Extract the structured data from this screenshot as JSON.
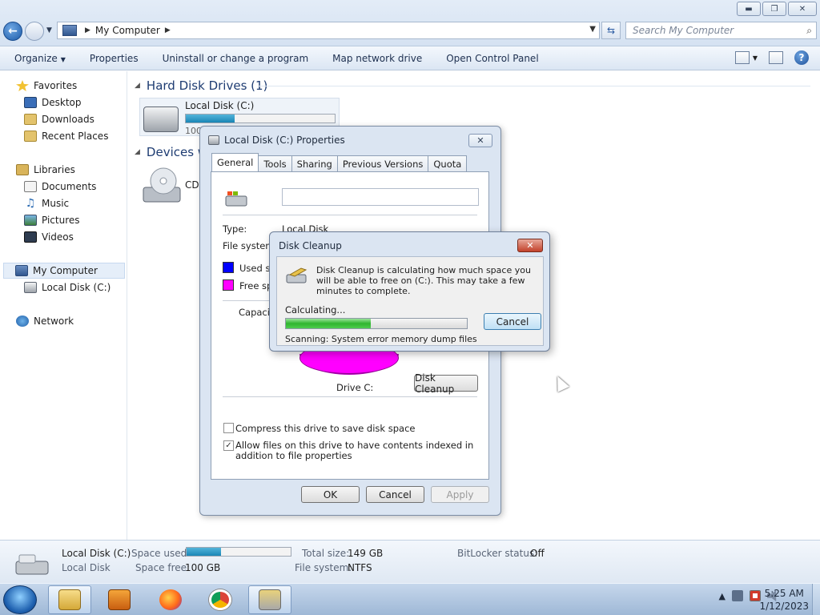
{
  "window": {
    "address_path": "My Computer",
    "search_placeholder": "Search My Computer",
    "controls": {
      "minimize": "▬",
      "maximize": "❐",
      "close": "✕"
    }
  },
  "command_bar": {
    "organize": "Organize",
    "properties": "Properties",
    "uninstall": "Uninstall or change a program",
    "map_drive": "Map network drive",
    "control_panel": "Open Control Panel"
  },
  "sidebar": {
    "favorites": "Favorites",
    "desktop": "Desktop",
    "downloads": "Downloads",
    "recent_places": "Recent Places",
    "libraries": "Libraries",
    "documents": "Documents",
    "music": "Music",
    "pictures": "Pictures",
    "videos": "Videos",
    "my_computer": "My Computer",
    "local_disk": "Local Disk (C:)",
    "network": "Network"
  },
  "content": {
    "hdd_header": "Hard Disk Drives (1)",
    "devices_header": "Devices wi",
    "drive_c_name": "Local Disk (C:)",
    "drive_c_free_text": "100",
    "drive_c_used_fraction": 0.33,
    "cd_label": "CD"
  },
  "properties_dialog": {
    "title": "Local Disk (C:) Properties",
    "tabs": [
      "General",
      "Tools",
      "Sharing",
      "Previous Versions",
      "Quota"
    ],
    "type_label": "Type:",
    "type_value": "Local Disk",
    "fs_label": "File system:",
    "used_label": "Used sp",
    "free_label": "Free spa",
    "capacity_label": "Capacit",
    "drive_label": "Drive C:",
    "disk_cleanup_button": "Disk Cleanup",
    "compress_label": "Compress this drive to save disk space",
    "index_label": "Allow files on this drive to have contents indexed in addition to file properties",
    "ok": "OK",
    "cancel": "Cancel",
    "apply": "Apply",
    "colors": {
      "used": "#0000ff",
      "free": "#ff00ff"
    }
  },
  "cleanup_dialog": {
    "title": "Disk Cleanup",
    "close": "✕",
    "message": "Disk Cleanup is calculating how much space you will be able to free on  (C:). This may take a few minutes to complete.",
    "calculating": "Calculating...",
    "progress_fraction": 0.47,
    "scanning": "Scanning:   System error memory dump files",
    "cancel": "Cancel"
  },
  "details_pane": {
    "name": "Local Disk (C:)",
    "type": "Local Disk",
    "space_used_label": "Space used:",
    "space_used_fraction": 0.33,
    "space_free_label": "Space free:",
    "space_free_value": "100 GB",
    "total_size_label": "Total size:",
    "total_size_value": "149 GB",
    "fs_label": "File system:",
    "fs_value": "NTFS",
    "bitlocker_label": "BitLocker status:",
    "bitlocker_value": "Off"
  },
  "taskbar": {
    "time": "5:25 AM",
    "date": "1/12/2023",
    "tray_up": "▲"
  }
}
